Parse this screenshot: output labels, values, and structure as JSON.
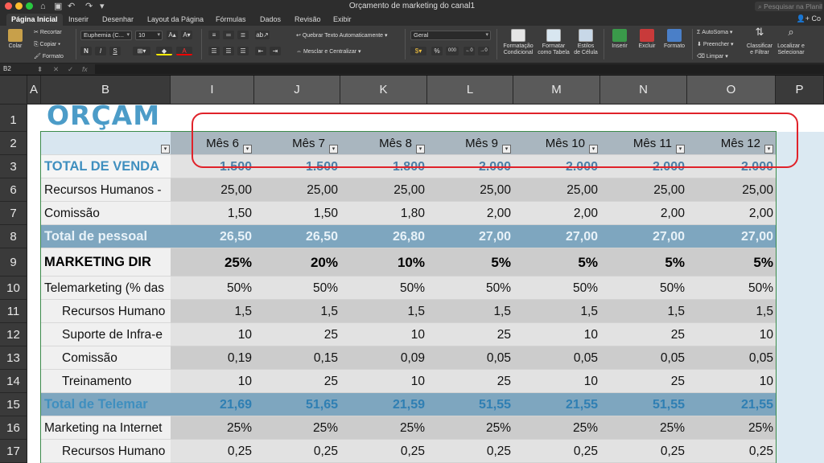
{
  "window": {
    "title": "Orçamento de marketing do canal1",
    "search_placeholder": "Pesquisar na Planilha",
    "share_label": "Co"
  },
  "tabs": [
    "Página Inicial",
    "Inserir",
    "Desenhar",
    "Layout da Página",
    "Fórmulas",
    "Dados",
    "Revisão",
    "Exibir"
  ],
  "ribbon": {
    "paste": "Colar",
    "cut": "Recortar",
    "copy": "Copiar",
    "format_painter": "Formato",
    "font_name": "Euphemia (C...",
    "font_size": "10",
    "wrap_text": "Quebrar Texto Automaticamente",
    "merge_center": "Mesclar e Centralizar",
    "number_format": "Geral",
    "cond_format": [
      "Formatação",
      "Condicional"
    ],
    "format_table": [
      "Formatar",
      "como Tabela"
    ],
    "cell_styles": [
      "Estilos",
      "de Célula"
    ],
    "insert": "Inserir",
    "delete": "Excluir",
    "format": "Formato",
    "autosum": "AutoSoma",
    "fill": "Preencher",
    "clear": "Limpar",
    "sort_filter": [
      "Classificar",
      "e Filtrar"
    ],
    "find_select": [
      "Localizar e",
      "Selecionar"
    ]
  },
  "formula_bar": {
    "name_box": "B2",
    "fx": "fx",
    "cancel": "✕",
    "enter": "✓"
  },
  "columns": [
    "A",
    "B",
    "I",
    "J",
    "K",
    "L",
    "M",
    "N",
    "O",
    "P"
  ],
  "rows": [
    "1",
    "2",
    "3",
    "6",
    "7",
    "8",
    "9",
    "10",
    "11",
    "12",
    "13",
    "14",
    "15",
    "16",
    "17"
  ],
  "sheet": {
    "title_text": "ORÇAM",
    "headers": [
      "Mês 6",
      "Mês 7",
      "Mês 8",
      "Mês 9",
      "Mês 10",
      "Mês 11",
      "Mês 12"
    ],
    "row_labels": {
      "r3": "TOTAL DE VENDA",
      "r6": "Recursos Humanos -",
      "r7": "Comissão",
      "r8": "Total de pessoal",
      "r9": "MARKETING DIR",
      "r10": "Telemarketing (% das",
      "r11": "Recursos Humano",
      "r12": "Suporte de Infra-e",
      "r13": "Comissão",
      "r14": "Treinamento",
      "r15": "Total de Telemar",
      "r16": "Marketing na Internet",
      "r17": "Recursos Humano"
    },
    "values": {
      "r3": [
        "1.500",
        "1.500",
        "1.800",
        "2.000",
        "2.000",
        "2.000",
        "2.000"
      ],
      "r6": [
        "25,00",
        "25,00",
        "25,00",
        "25,00",
        "25,00",
        "25,00",
        "25,00"
      ],
      "r7": [
        "1,50",
        "1,50",
        "1,80",
        "2,00",
        "2,00",
        "2,00",
        "2,00"
      ],
      "r8": [
        "26,50",
        "26,50",
        "26,80",
        "27,00",
        "27,00",
        "27,00",
        "27,00"
      ],
      "r9": [
        "25%",
        "20%",
        "10%",
        "5%",
        "5%",
        "5%",
        "5%"
      ],
      "r10": [
        "50%",
        "50%",
        "50%",
        "50%",
        "50%",
        "50%",
        "50%"
      ],
      "r11": [
        "1,5",
        "1,5",
        "1,5",
        "1,5",
        "1,5",
        "1,5",
        "1,5"
      ],
      "r12": [
        "10",
        "25",
        "10",
        "25",
        "10",
        "25",
        "10"
      ],
      "r13": [
        "0,19",
        "0,15",
        "0,09",
        "0,05",
        "0,05",
        "0,05",
        "0,05"
      ],
      "r14": [
        "10",
        "25",
        "10",
        "25",
        "10",
        "25",
        "10"
      ],
      "r15": [
        "21,69",
        "51,65",
        "21,59",
        "51,55",
        "21,55",
        "51,55",
        "21,55"
      ],
      "r16": [
        "25%",
        "25%",
        "25%",
        "25%",
        "25%",
        "25%",
        "25%"
      ],
      "r17": [
        "0,25",
        "0,25",
        "0,25",
        "0,25",
        "0,25",
        "0,25",
        "0,25"
      ]
    }
  },
  "colors": {
    "accent_blue": "#4c9cc8",
    "total_row_bg": "#7ea6bf",
    "header_band": "#a9b6bf",
    "annotation": "#e0222a"
  }
}
